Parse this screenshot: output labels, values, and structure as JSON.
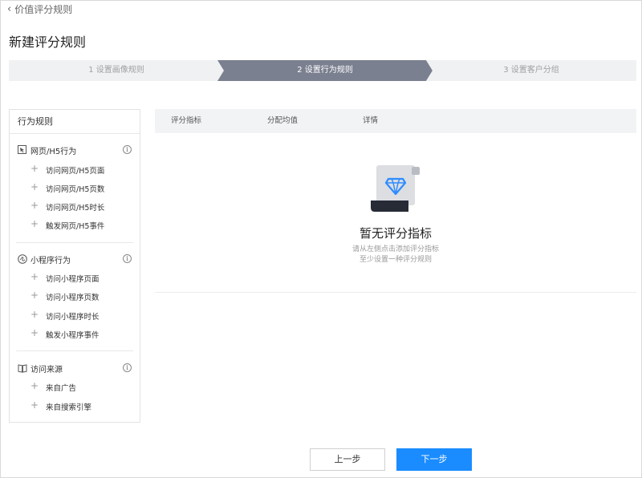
{
  "header": {
    "back_label": "价值评分规则",
    "page_title": "新建评分规则"
  },
  "steps": [
    {
      "label": "1 设置画像规则",
      "active": false
    },
    {
      "label": "2 设置行为规则",
      "active": true
    },
    {
      "label": "3 设置客户分组",
      "active": false
    }
  ],
  "colors": {
    "step_active": "#7b8090",
    "step_inactive": "#f0f1f3",
    "primary": "#1a8cff"
  },
  "left_panel": {
    "title": "行为规则",
    "groups": [
      {
        "icon": "web-pointer-icon",
        "label": "网页/H5行为",
        "items": [
          "访问网页/H5页面",
          "访问网页/H5页数",
          "访问网页/H5时长",
          "触发网页/H5事件"
        ]
      },
      {
        "icon": "mini-program-icon",
        "label": "小程序行为",
        "items": [
          "访问小程序页面",
          "访问小程序页数",
          "访问小程序时长",
          "触发小程序事件"
        ]
      },
      {
        "icon": "book-icon",
        "label": "访问来源",
        "items": [
          "来自广告",
          "来自搜索引擎"
        ]
      }
    ]
  },
  "table": {
    "columns": [
      "评分指标",
      "分配均值",
      "详情"
    ]
  },
  "empty": {
    "title": "暂无评分指标",
    "line1": "请从左侧点击添加评分指标",
    "line2": "至少设置一种评分规则"
  },
  "footer": {
    "prev_label": "上一步",
    "next_label": "下一步"
  }
}
